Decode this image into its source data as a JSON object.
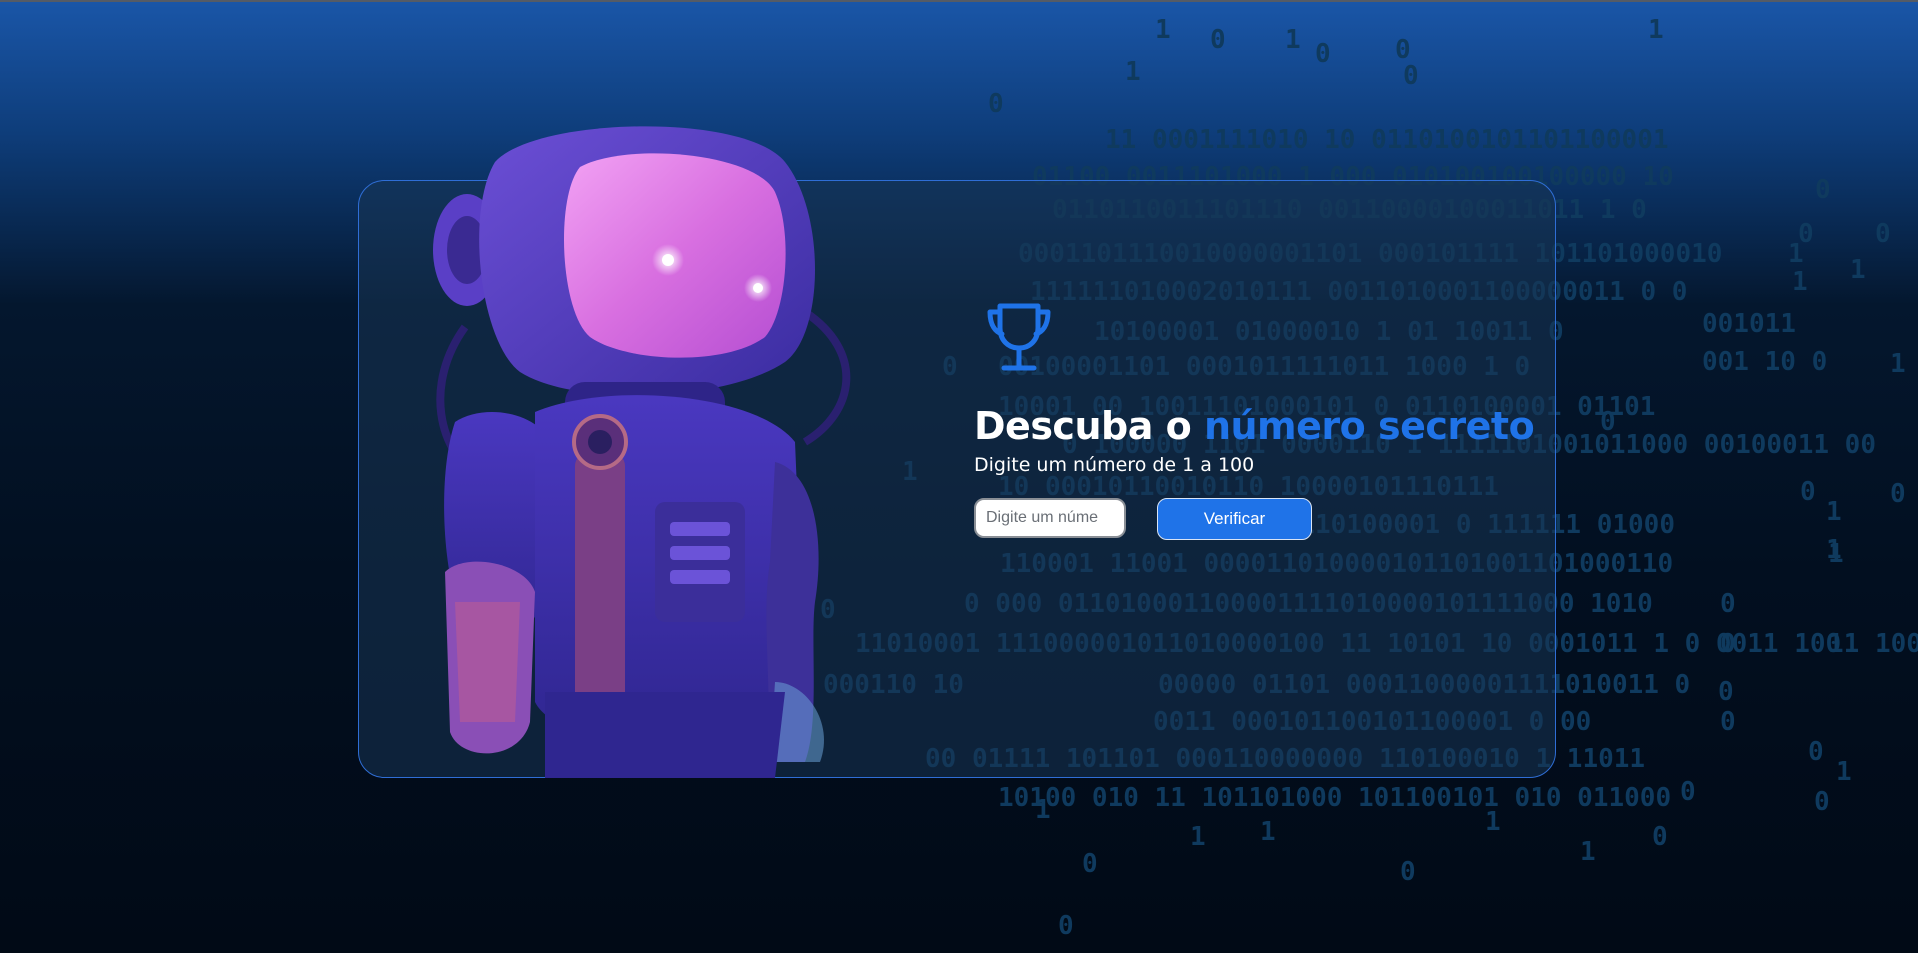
{
  "title": {
    "prefix": "Descuba o",
    "accent": "número secreto"
  },
  "subtitle": "Digite um número de 1 a 100",
  "guess_input": {
    "value": "",
    "placeholder": "Digite um número:"
  },
  "verify_button": {
    "label": "Verificar"
  },
  "icons": {
    "trophy": "trophy-icon",
    "illustration": "astronaut-robot-illustration"
  },
  "colors": {
    "accent": "#1f73e8",
    "title_text": "#ffffff",
    "card_border": "#2f6ed6",
    "binary_text": "#0f3a5e"
  }
}
